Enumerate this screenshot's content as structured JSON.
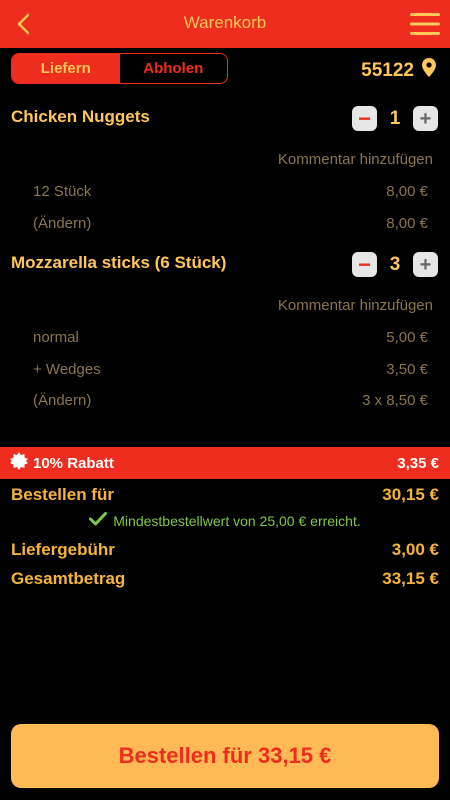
{
  "header": {
    "title": "Warenkorb",
    "back_icon": "chevron-left-icon",
    "menu_icon": "hamburger-menu-icon"
  },
  "delivery_toggle": {
    "options": [
      "Liefern",
      "Abholen"
    ],
    "selected": "Liefern"
  },
  "location": {
    "postal_code": "55122",
    "icon": "map-pin-icon"
  },
  "items": [
    {
      "name": "Chicken Nuggets",
      "quantity": "1",
      "comment_label": "Kommentar hinzufügen",
      "lines": [
        {
          "label": "12 Stück",
          "price": "8,00 €"
        },
        {
          "label": "(Ändern)",
          "price": "8,00 €"
        }
      ]
    },
    {
      "name": "Mozzarella sticks (6 Stück)",
      "quantity": "3",
      "comment_label": "Kommentar hinzufügen",
      "lines": [
        {
          "label": "normal",
          "price": "5,00 €"
        },
        {
          "label": "+ Wedges",
          "price": "3,50 €"
        },
        {
          "label": "(Ändern)",
          "price": "3 x 8,50 €"
        }
      ]
    }
  ],
  "discount": {
    "label": "10% Rabatt",
    "amount": "3,35 €",
    "icon": "badge-icon"
  },
  "summary": {
    "subtotal_label": "Bestellen für",
    "subtotal": "30,15 €",
    "min_order_message": "Mindestbestellwert von 25,00 € erreicht.",
    "delivery_fee_label": "Liefergebühr",
    "delivery_fee": "3,00 €",
    "total_label": "Gesamtbetrag",
    "total": "33,15 €"
  },
  "order_button": {
    "label": "Bestellen für 33,15 €"
  },
  "colors": {
    "primary_red": "#ef2d1f",
    "accent_yellow": "#ffc65a",
    "button_bg": "#ffb955",
    "success_green": "#7ec94a"
  }
}
